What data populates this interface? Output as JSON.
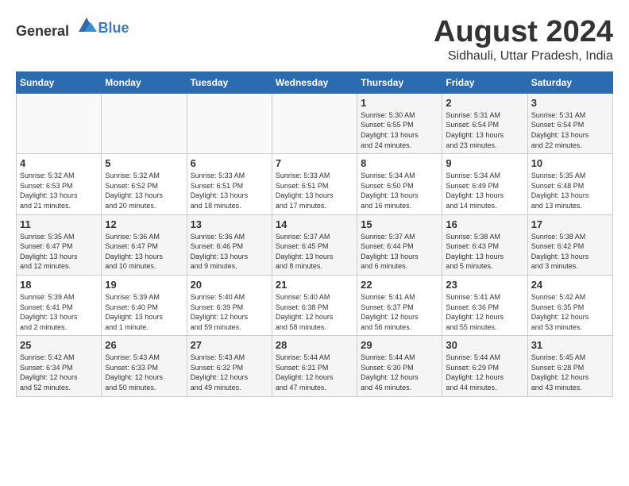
{
  "logo": {
    "general": "General",
    "blue": "Blue"
  },
  "title": "August 2024",
  "subtitle": "Sidhauli, Uttar Pradesh, India",
  "days_of_week": [
    "Sunday",
    "Monday",
    "Tuesday",
    "Wednesday",
    "Thursday",
    "Friday",
    "Saturday"
  ],
  "weeks": [
    [
      {
        "day": "",
        "info": ""
      },
      {
        "day": "",
        "info": ""
      },
      {
        "day": "",
        "info": ""
      },
      {
        "day": "",
        "info": ""
      },
      {
        "day": "1",
        "info": "Sunrise: 5:30 AM\nSunset: 6:55 PM\nDaylight: 13 hours\nand 24 minutes."
      },
      {
        "day": "2",
        "info": "Sunrise: 5:31 AM\nSunset: 6:54 PM\nDaylight: 13 hours\nand 23 minutes."
      },
      {
        "day": "3",
        "info": "Sunrise: 5:31 AM\nSunset: 6:54 PM\nDaylight: 13 hours\nand 22 minutes."
      }
    ],
    [
      {
        "day": "4",
        "info": "Sunrise: 5:32 AM\nSunset: 6:53 PM\nDaylight: 13 hours\nand 21 minutes."
      },
      {
        "day": "5",
        "info": "Sunrise: 5:32 AM\nSunset: 6:52 PM\nDaylight: 13 hours\nand 20 minutes."
      },
      {
        "day": "6",
        "info": "Sunrise: 5:33 AM\nSunset: 6:51 PM\nDaylight: 13 hours\nand 18 minutes."
      },
      {
        "day": "7",
        "info": "Sunrise: 5:33 AM\nSunset: 6:51 PM\nDaylight: 13 hours\nand 17 minutes."
      },
      {
        "day": "8",
        "info": "Sunrise: 5:34 AM\nSunset: 6:50 PM\nDaylight: 13 hours\nand 16 minutes."
      },
      {
        "day": "9",
        "info": "Sunrise: 5:34 AM\nSunset: 6:49 PM\nDaylight: 13 hours\nand 14 minutes."
      },
      {
        "day": "10",
        "info": "Sunrise: 5:35 AM\nSunset: 6:48 PM\nDaylight: 13 hours\nand 13 minutes."
      }
    ],
    [
      {
        "day": "11",
        "info": "Sunrise: 5:35 AM\nSunset: 6:47 PM\nDaylight: 13 hours\nand 12 minutes."
      },
      {
        "day": "12",
        "info": "Sunrise: 5:36 AM\nSunset: 6:47 PM\nDaylight: 13 hours\nand 10 minutes."
      },
      {
        "day": "13",
        "info": "Sunrise: 5:36 AM\nSunset: 6:46 PM\nDaylight: 13 hours\nand 9 minutes."
      },
      {
        "day": "14",
        "info": "Sunrise: 5:37 AM\nSunset: 6:45 PM\nDaylight: 13 hours\nand 8 minutes."
      },
      {
        "day": "15",
        "info": "Sunrise: 5:37 AM\nSunset: 6:44 PM\nDaylight: 13 hours\nand 6 minutes."
      },
      {
        "day": "16",
        "info": "Sunrise: 5:38 AM\nSunset: 6:43 PM\nDaylight: 13 hours\nand 5 minutes."
      },
      {
        "day": "17",
        "info": "Sunrise: 5:38 AM\nSunset: 6:42 PM\nDaylight: 13 hours\nand 3 minutes."
      }
    ],
    [
      {
        "day": "18",
        "info": "Sunrise: 5:39 AM\nSunset: 6:41 PM\nDaylight: 13 hours\nand 2 minutes."
      },
      {
        "day": "19",
        "info": "Sunrise: 5:39 AM\nSunset: 6:40 PM\nDaylight: 13 hours\nand 1 minute."
      },
      {
        "day": "20",
        "info": "Sunrise: 5:40 AM\nSunset: 6:39 PM\nDaylight: 12 hours\nand 59 minutes."
      },
      {
        "day": "21",
        "info": "Sunrise: 5:40 AM\nSunset: 6:38 PM\nDaylight: 12 hours\nand 58 minutes."
      },
      {
        "day": "22",
        "info": "Sunrise: 5:41 AM\nSunset: 6:37 PM\nDaylight: 12 hours\nand 56 minutes."
      },
      {
        "day": "23",
        "info": "Sunrise: 5:41 AM\nSunset: 6:36 PM\nDaylight: 12 hours\nand 55 minutes."
      },
      {
        "day": "24",
        "info": "Sunrise: 5:42 AM\nSunset: 6:35 PM\nDaylight: 12 hours\nand 53 minutes."
      }
    ],
    [
      {
        "day": "25",
        "info": "Sunrise: 5:42 AM\nSunset: 6:34 PM\nDaylight: 12 hours\nand 52 minutes."
      },
      {
        "day": "26",
        "info": "Sunrise: 5:43 AM\nSunset: 6:33 PM\nDaylight: 12 hours\nand 50 minutes."
      },
      {
        "day": "27",
        "info": "Sunrise: 5:43 AM\nSunset: 6:32 PM\nDaylight: 12 hours\nand 49 minutes."
      },
      {
        "day": "28",
        "info": "Sunrise: 5:44 AM\nSunset: 6:31 PM\nDaylight: 12 hours\nand 47 minutes."
      },
      {
        "day": "29",
        "info": "Sunrise: 5:44 AM\nSunset: 6:30 PM\nDaylight: 12 hours\nand 46 minutes."
      },
      {
        "day": "30",
        "info": "Sunrise: 5:44 AM\nSunset: 6:29 PM\nDaylight: 12 hours\nand 44 minutes."
      },
      {
        "day": "31",
        "info": "Sunrise: 5:45 AM\nSunset: 6:28 PM\nDaylight: 12 hours\nand 43 minutes."
      }
    ]
  ]
}
